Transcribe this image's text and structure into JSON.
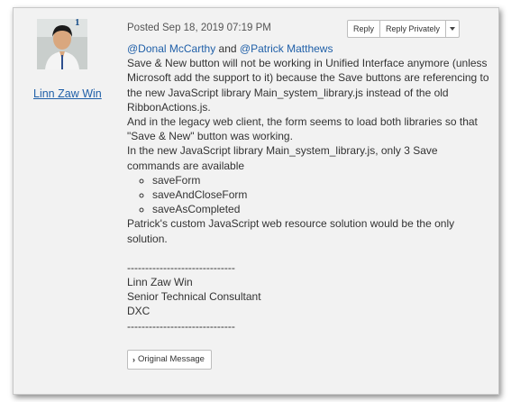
{
  "author": {
    "name": "Linn Zaw Win",
    "badge": "1"
  },
  "post": {
    "posted": "Posted Sep 18, 2019 07:19 PM"
  },
  "actions": {
    "reply": "Reply",
    "reply_privately": "Reply Privately",
    "original_message": "Original Message"
  },
  "message": {
    "mention1": "@Donal McCarthy",
    "and": " and ",
    "mention2": "@Patrick Matthews",
    "para1": "Save & New button will not be working in Unified Interface anymore (unless Microsoft add the support to it) because the Save buttons are referencing to the new JavaScript library Main_system_library.js instead of the old RibbonActions.js.",
    "para2": "And in the legacy web client, the form seems to load both libraries so that \"Save & New\" button was working.",
    "para3": "In the new JavaScript library Main_system_library.js, only 3 Save commands are available",
    "commands": [
      "saveForm",
      "saveAndCloseForm",
      "saveAsCompleted"
    ],
    "para4": "Patrick's custom JavaScript web resource solution would be the only solution."
  },
  "signature": {
    "divider": "------------------------------",
    "name": "Linn Zaw Win",
    "title": "Senior Technical Consultant",
    "company": "DXC"
  },
  "colors": {
    "link": "#1f5fa8",
    "text": "#333333",
    "panel": "#f2f2f2"
  }
}
